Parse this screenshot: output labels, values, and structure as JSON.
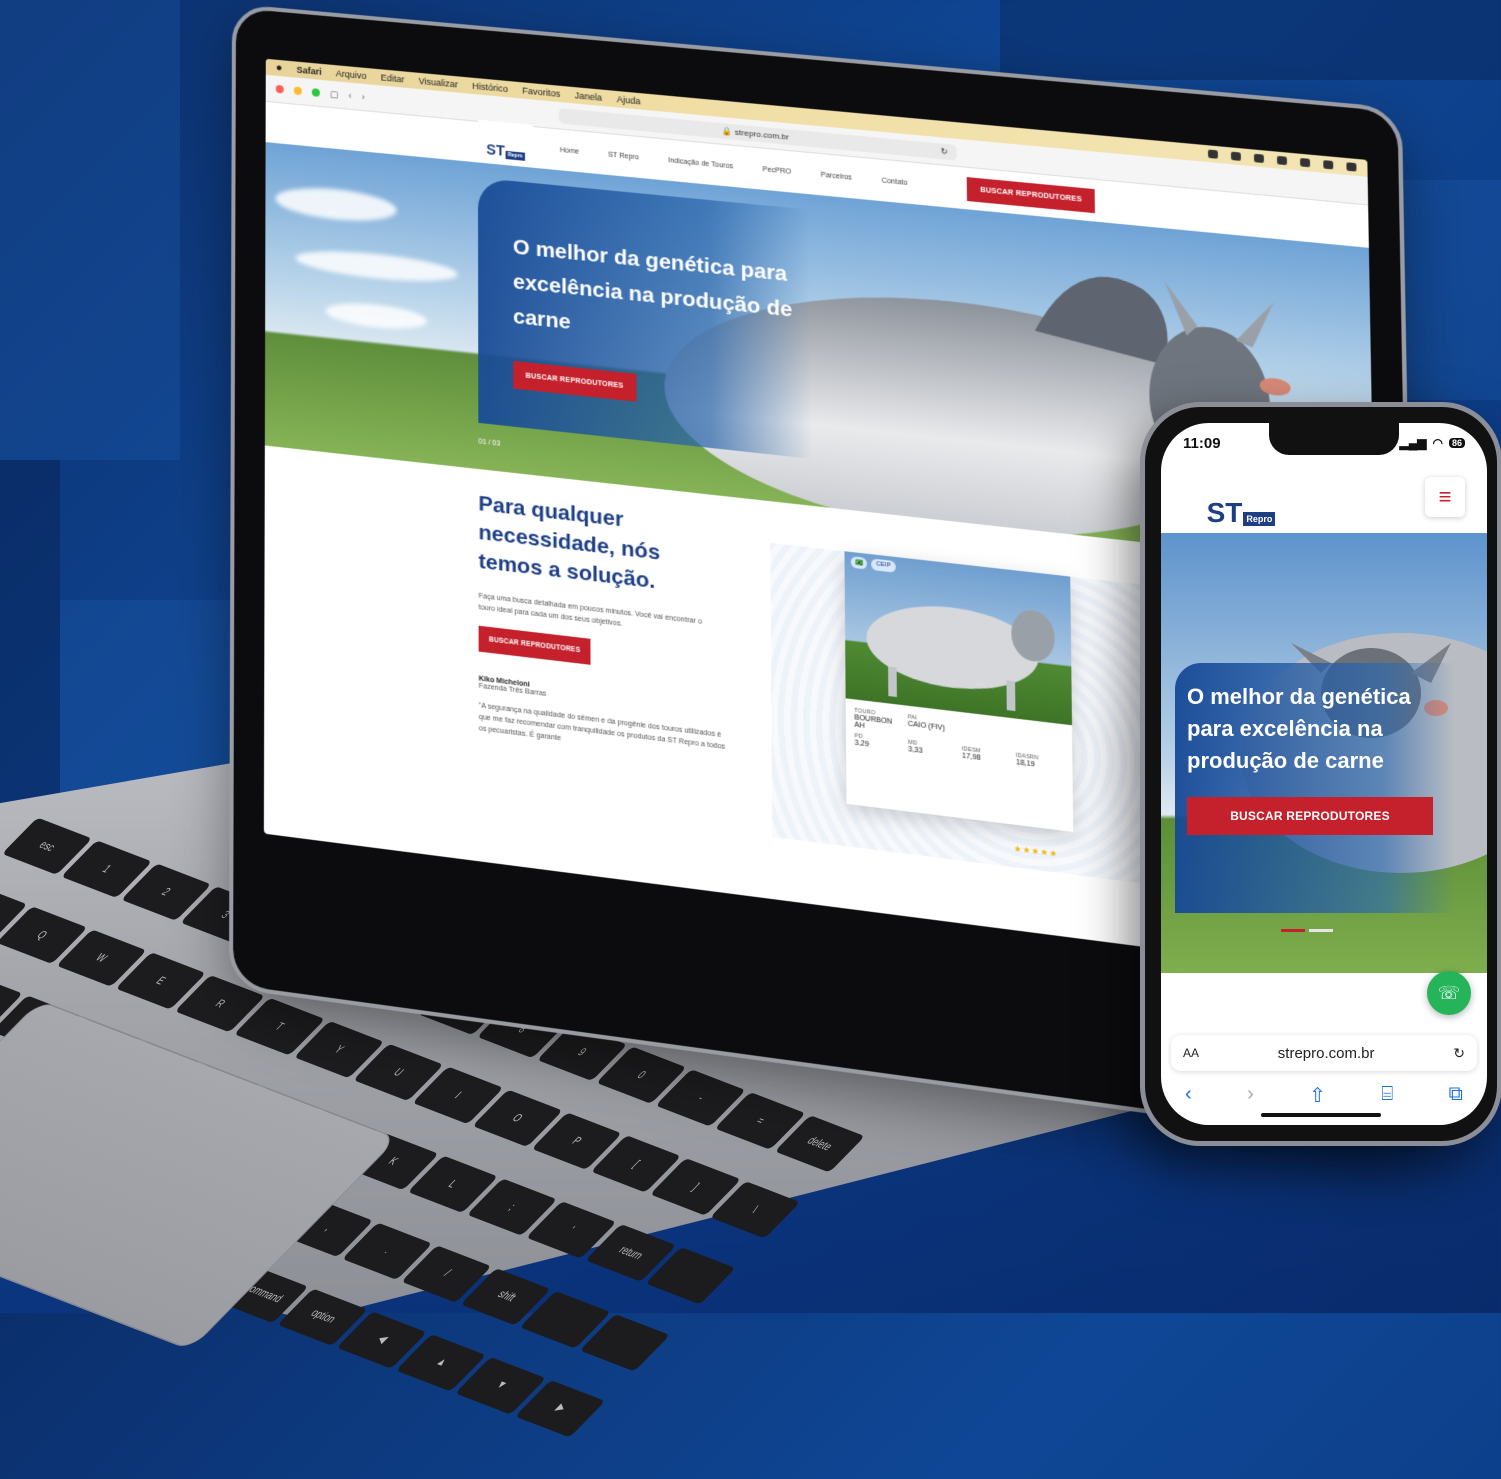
{
  "laptop": {
    "menubar": {
      "app": "Safari",
      "items": [
        "Arquivo",
        "Editar",
        "Visualizar",
        "Histórico",
        "Favoritos",
        "Janela",
        "Ajuda"
      ]
    },
    "browser": {
      "url": "strepro.com.br"
    },
    "site": {
      "logo": {
        "mark": "ST",
        "sub": "Repro"
      },
      "nav": [
        "Home",
        "ST Repro",
        "Indicação de Touros",
        "PecPRO",
        "Parceiros",
        "Contato"
      ],
      "cta": "BUSCAR REPRODUTORES",
      "hero": {
        "title": "O melhor da genética para excelência na produção de carne",
        "button": "BUSCAR REPRODUTORES",
        "slides": "01 / 03"
      },
      "section": {
        "title": "Para qualquer necessidade, nós temos a solução.",
        "description": "Faça uma busca detalhada em poucos minutos. Você vai encontrar o touro ideal para cada um dos seus objetivos.",
        "button": "BUSCAR REPRODUTORES"
      },
      "testimonial": {
        "name": "Kiko Micheloni",
        "farm": "Fazenda Três Barras",
        "quote": "\"A segurança na qualidade do sêmen e da progênie dos touros utilizados é que me faz recomendar com tranquilidade os produtos da ST Repro a todos os pecuaristas. É garante"
      },
      "bull_card": {
        "tag": "CEIP",
        "fields": [
          {
            "label": "TOURO",
            "value": "BOURBON AH"
          },
          {
            "label": "PAI",
            "value": "CAIO (FIV)"
          },
          {
            "label": "PD",
            "value": "3,29"
          },
          {
            "label": "MD",
            "value": "3,33"
          },
          {
            "label": "IDESM",
            "value": "17,98"
          },
          {
            "label": "IDASRN",
            "value": "18,19"
          }
        ],
        "stars": "★★★★★"
      }
    }
  },
  "phone": {
    "time": "11:09",
    "battery": "86",
    "logo": {
      "mark": "ST",
      "sub": "Repro"
    },
    "menu_icon": "≡",
    "hero": {
      "title": "O melhor da genética para excelência na produção de carne",
      "button": "BUSCAR REPRODUTORES"
    },
    "url_bar": {
      "aa": "AA",
      "address": "strepro.com.br"
    },
    "whatsapp_icon": "☏"
  },
  "colors": {
    "brand_blue": "#1d3e86",
    "accent_red": "#c4212d",
    "whatsapp": "#25b45a"
  }
}
